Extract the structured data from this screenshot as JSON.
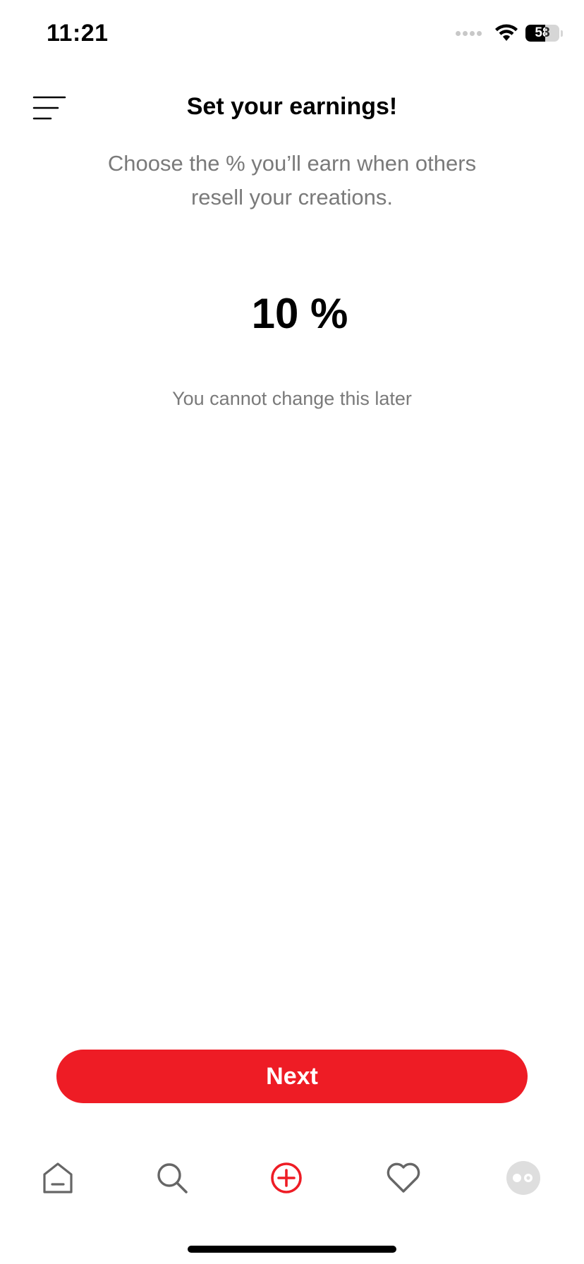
{
  "status_bar": {
    "time": "11:21",
    "battery": "58",
    "battery_level": 0.58
  },
  "header": {
    "title": "Set your earnings!",
    "menu_icon": "hamburger-menu-icon"
  },
  "content": {
    "subtitle": "Choose the % you’ll earn when others resell your creations.",
    "percent_value": "10 %",
    "note": "You cannot change this later"
  },
  "actions": {
    "next_label": "Next"
  },
  "tabbar": {
    "items": [
      {
        "icon": "home-icon"
      },
      {
        "icon": "search-icon"
      },
      {
        "icon": "add-circle-icon",
        "active": true
      },
      {
        "icon": "heart-icon"
      },
      {
        "icon": "profile-avatar-icon"
      }
    ]
  },
  "colors": {
    "accent": "#EE1C25",
    "muted_text": "#7A7A7A",
    "icon_gray": "#666666"
  }
}
